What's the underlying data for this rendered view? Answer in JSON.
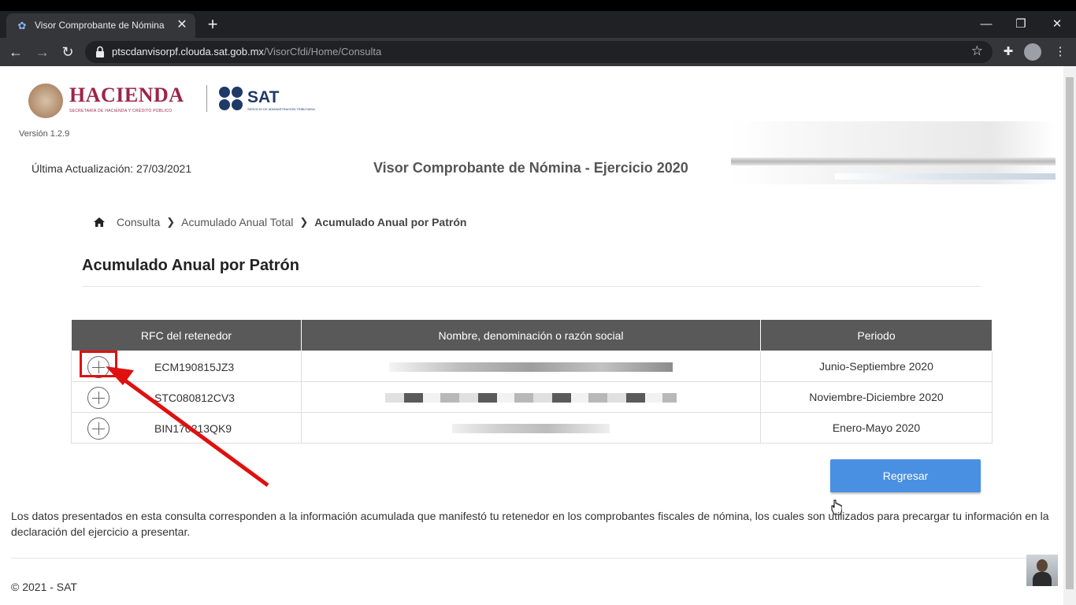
{
  "browser": {
    "tab_title": "Visor Comprobante de Nómina",
    "url_host": "ptscdanvisorpf.clouda.sat.gob.mx",
    "url_path": "/VisorCfdi/Home/Consulta"
  },
  "header": {
    "hacienda_logo_text": "HACIENDA",
    "hacienda_logo_subtext": "SECRETARÍA DE HACIENDA Y CRÉDITO PÚBLICO",
    "sat_logo_text": "SAT",
    "sat_logo_subtext": "SERVICIO DE ADMINISTRACIÓN TRIBUTARIA",
    "version": "Versión 1.2.9",
    "last_update": "Última Actualización: 27/03/2021",
    "title": "Visor Comprobante de Nómina - Ejercicio 2020"
  },
  "breadcrumb": {
    "items": [
      "Consulta",
      "Acumulado Anual Total"
    ],
    "current": "Acumulado Anual por Patrón"
  },
  "section_title": "Acumulado Anual por Patrón",
  "table": {
    "headers": [
      "RFC del retenedor",
      "Nombre, denominación o razón social",
      "Periodo"
    ],
    "rows": [
      {
        "rfc": "ECM190815JZ3",
        "periodo": "Junio-Septiembre 2020"
      },
      {
        "rfc": "STC080812CV3",
        "periodo": "Noviembre-Diciembre 2020"
      },
      {
        "rfc": "BIN170213QK9",
        "periodo": "Enero-Mayo 2020"
      }
    ]
  },
  "buttons": {
    "regresar": "Regresar"
  },
  "footnote": "Los datos presentados en esta consulta corresponden a la información acumulada que manifestó tu retenedor en los comprobantes fiscales de nómina, los cuales son utilizados para precargar tu información en la declaración del ejercicio a presentar.",
  "copyright": "© 2021 - SAT",
  "colors": {
    "header_bg": "#595959",
    "button_bg": "#4a90e2",
    "highlight": "#e01010",
    "hacienda_brand": "#9d2449",
    "sat_brand": "#1f3a68"
  }
}
